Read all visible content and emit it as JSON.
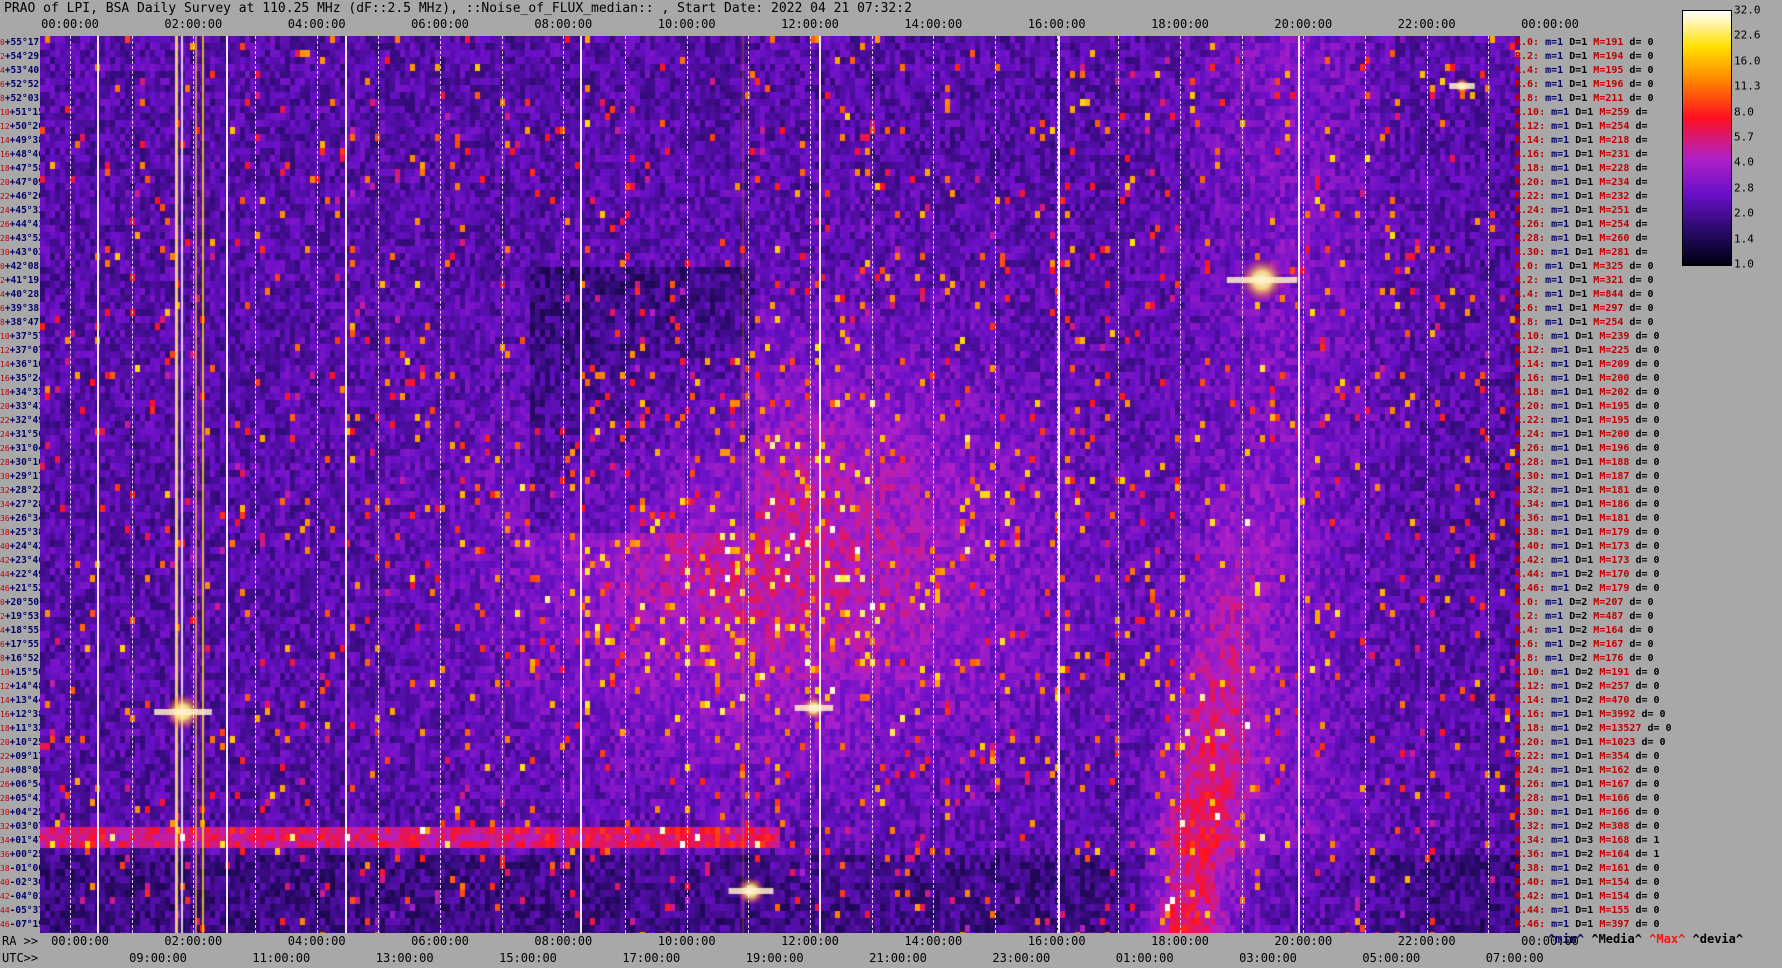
{
  "title": "PRAO of LPI, BSA Daily Survey at 110.25 MHz (dF::2.5 MHz), ::Noise_of_FLUX_median:: , Start Date: 2022 04 21 07:32:2",
  "top_ticks": [
    "00:00:00",
    "02:00:00",
    "04:00:00",
    "06:00:00",
    "08:00:00",
    "10:00:00",
    "12:00:00",
    "14:00:00",
    "16:00:00",
    "18:00:00",
    "20:00:00",
    "22:00:00",
    "00:00:00"
  ],
  "ra_prefix": "RA >>",
  "ra_ticks": [
    "00:00:00",
    "02:00:00",
    "04:00:00",
    "06:00:00",
    "08:00:00",
    "10:00:00",
    "12:00:00",
    "14:00:00",
    "16:00:00",
    "18:00:00",
    "20:00:00",
    "22:00:00",
    "00:00:00"
  ],
  "utc_prefix": "UTC>>",
  "utc_ticks": [
    "09:00:00",
    "11:00:00",
    "13:00:00",
    "15:00:00",
    "17:00:00",
    "19:00:00",
    "21:00:00",
    "23:00:00",
    "01:00:00",
    "03:00:00",
    "05:00:00",
    "07:00:00"
  ],
  "colorbar": {
    "labels": [
      "32.0",
      "22.6",
      "16.0",
      "11.3",
      "8.0",
      "5.7",
      "4.0",
      "2.8",
      "2.0",
      "1.4",
      "1.0"
    ],
    "colors": [
      "#000010",
      "#2a0a6b",
      "#6a10c8",
      "#b020c8",
      "#ff1020",
      "#ff8000",
      "#ffe000",
      "#ffffff"
    ]
  },
  "legend": {
    "min": "^min^",
    "median": "^Media^",
    "max": "^Max^",
    "dev": "^devia^"
  },
  "declinations": [
    {
      "i": "0",
      "d": "+55°17'"
    },
    {
      "i": "2",
      "d": "+54°29'"
    },
    {
      "i": "4",
      "d": "+53°40'"
    },
    {
      "i": "6",
      "d": "+52°52'"
    },
    {
      "i": "8",
      "d": "+52°03'"
    },
    {
      "i": "10",
      "d": "+51°15'"
    },
    {
      "i": "12",
      "d": "+50°26'"
    },
    {
      "i": "14",
      "d": "+49°38'"
    },
    {
      "i": "16",
      "d": "+48°46'"
    },
    {
      "i": "18",
      "d": "+47°58'"
    },
    {
      "i": "20",
      "d": "+47°09'"
    },
    {
      "i": "22",
      "d": "+46°20'"
    },
    {
      "i": "24",
      "d": "+45°31'"
    },
    {
      "i": "26",
      "d": "+44°41'"
    },
    {
      "i": "28",
      "d": "+43°52'"
    },
    {
      "i": "30",
      "d": "+43°03'"
    },
    {
      "i": "0",
      "d": "+42°08'"
    },
    {
      "i": "2",
      "d": "+41°19'"
    },
    {
      "i": "4",
      "d": "+40°28'"
    },
    {
      "i": "6",
      "d": "+39°38'"
    },
    {
      "i": "8",
      "d": "+38°47'"
    },
    {
      "i": "10",
      "d": "+37°57'"
    },
    {
      "i": "12",
      "d": "+37°07'"
    },
    {
      "i": "14",
      "d": "+36°16'"
    },
    {
      "i": "16",
      "d": "+35°24'"
    },
    {
      "i": "18",
      "d": "+34°32'"
    },
    {
      "i": "20",
      "d": "+33°41'"
    },
    {
      "i": "22",
      "d": "+32°49'"
    },
    {
      "i": "24",
      "d": "+31°56'"
    },
    {
      "i": "26",
      "d": "+31°04'"
    },
    {
      "i": "28",
      "d": "+30°10'"
    },
    {
      "i": "30",
      "d": "+29°17'"
    },
    {
      "i": "32",
      "d": "+28°22'"
    },
    {
      "i": "34",
      "d": "+27°28'"
    },
    {
      "i": "36",
      "d": "+26°34'"
    },
    {
      "i": "38",
      "d": "+25°38'"
    },
    {
      "i": "40",
      "d": "+24°42'"
    },
    {
      "i": "42",
      "d": "+23°46'"
    },
    {
      "i": "44",
      "d": "+22°49'"
    },
    {
      "i": "46",
      "d": "+21°52'"
    },
    {
      "i": "0",
      "d": "+20°50'"
    },
    {
      "i": "2",
      "d": "+19°53'"
    },
    {
      "i": "4",
      "d": "+18°55'"
    },
    {
      "i": "6",
      "d": "+17°55'"
    },
    {
      "i": "8",
      "d": "+16°52'"
    },
    {
      "i": "10",
      "d": "+15°50'"
    },
    {
      "i": "12",
      "d": "+14°48'"
    },
    {
      "i": "14",
      "d": "+13°44'"
    },
    {
      "i": "16",
      "d": "+12°38'"
    },
    {
      "i": "18",
      "d": "+11°32'"
    },
    {
      "i": "20",
      "d": "+10°25'"
    },
    {
      "i": "22",
      "d": "+09°17'"
    },
    {
      "i": "24",
      "d": "+08°05'"
    },
    {
      "i": "26",
      "d": "+06°54'"
    },
    {
      "i": "28",
      "d": "+05°41'"
    },
    {
      "i": "30",
      "d": "+04°25'"
    },
    {
      "i": "32",
      "d": "+03°07'"
    },
    {
      "i": "34",
      "d": "+01°47'"
    },
    {
      "i": "36",
      "d": "+00°25'"
    },
    {
      "i": "38",
      "d": "-01°00'"
    },
    {
      "i": "40",
      "d": "-02°30'"
    },
    {
      "i": "42",
      "d": "-04°01'"
    },
    {
      "i": "44",
      "d": "-05°37'"
    },
    {
      "i": "46",
      "d": "-07°19'"
    }
  ],
  "side_rows": [
    {
      "r": "R.0:",
      "m": "m=1",
      "D": "D=1",
      "M": "M=191",
      "d": "d= 0"
    },
    {
      "r": "R.2:",
      "m": "m=1",
      "D": "D=1",
      "M": "M=194",
      "d": "d= 0"
    },
    {
      "r": "R.4:",
      "m": "m=1",
      "D": "D=1",
      "M": "M=195",
      "d": "d= 0"
    },
    {
      "r": "R.6:",
      "m": "m=1",
      "D": "D=1",
      "M": "M=196",
      "d": "d= 0"
    },
    {
      "r": "R.8:",
      "m": "m=1",
      "D": "D=1",
      "M": "M=211",
      "d": "d= 0"
    },
    {
      "r": "R.10:",
      "m": "m=1",
      "D": "D=1",
      "M": "M=259",
      "d": "d="
    },
    {
      "r": "R.12:",
      "m": "m=1",
      "D": "D=1",
      "M": "M=254",
      "d": "d="
    },
    {
      "r": "R.14:",
      "m": "m=1",
      "D": "D=1",
      "M": "M=218",
      "d": "d="
    },
    {
      "r": "R.16:",
      "m": "m=1",
      "D": "D=1",
      "M": "M=231",
      "d": "d="
    },
    {
      "r": "R.18:",
      "m": "m=1",
      "D": "D=1",
      "M": "M=228",
      "d": "d="
    },
    {
      "r": "R.20:",
      "m": "m=1",
      "D": "D=1",
      "M": "M=234",
      "d": "d="
    },
    {
      "r": "R.22:",
      "m": "m=1",
      "D": "D=1",
      "M": "M=232",
      "d": "d="
    },
    {
      "r": "R.24:",
      "m": "m=1",
      "D": "D=1",
      "M": "M=251",
      "d": "d="
    },
    {
      "r": "R.26:",
      "m": "m=1",
      "D": "D=1",
      "M": "M=254",
      "d": "d="
    },
    {
      "r": "R.28:",
      "m": "m=1",
      "D": "D=1",
      "M": "M=260",
      "d": "d="
    },
    {
      "r": "R.30:",
      "m": "m=1",
      "D": "D=1",
      "M": "M=281",
      "d": "d="
    },
    {
      "r": "R.0:",
      "m": "m=1",
      "D": "D=1",
      "M": "M=325",
      "d": "d= 0"
    },
    {
      "r": "R.2:",
      "m": "m=1",
      "D": "D=1",
      "M": "M=321",
      "d": "d= 0"
    },
    {
      "r": "R.4:",
      "m": "m=1",
      "D": "D=1",
      "M": "M=844",
      "d": "d= 0"
    },
    {
      "r": "R.6:",
      "m": "m=1",
      "D": "D=1",
      "M": "M=297",
      "d": "d= 0"
    },
    {
      "r": "R.8:",
      "m": "m=1",
      "D": "D=1",
      "M": "M=254",
      "d": "d= 0"
    },
    {
      "r": "R.10:",
      "m": "m=1",
      "D": "D=1",
      "M": "M=239",
      "d": "d= 0"
    },
    {
      "r": "R.12:",
      "m": "m=1",
      "D": "D=1",
      "M": "M=225",
      "d": "d= 0"
    },
    {
      "r": "R.14:",
      "m": "m=1",
      "D": "D=1",
      "M": "M=209",
      "d": "d= 0"
    },
    {
      "r": "R.16:",
      "m": "m=1",
      "D": "D=1",
      "M": "M=200",
      "d": "d= 0"
    },
    {
      "r": "R.18:",
      "m": "m=1",
      "D": "D=1",
      "M": "M=202",
      "d": "d= 0"
    },
    {
      "r": "R.20:",
      "m": "m=1",
      "D": "D=1",
      "M": "M=195",
      "d": "d= 0"
    },
    {
      "r": "R.22:",
      "m": "m=1",
      "D": "D=1",
      "M": "M=195",
      "d": "d= 0"
    },
    {
      "r": "R.24:",
      "m": "m=1",
      "D": "D=1",
      "M": "M=200",
      "d": "d= 0"
    },
    {
      "r": "R.26:",
      "m": "m=1",
      "D": "D=1",
      "M": "M=196",
      "d": "d= 0"
    },
    {
      "r": "R.28:",
      "m": "m=1",
      "D": "D=1",
      "M": "M=188",
      "d": "d= 0"
    },
    {
      "r": "R.30:",
      "m": "m=1",
      "D": "D=1",
      "M": "M=187",
      "d": "d= 0"
    },
    {
      "r": "R.32:",
      "m": "m=1",
      "D": "D=1",
      "M": "M=181",
      "d": "d= 0"
    },
    {
      "r": "R.34:",
      "m": "m=1",
      "D": "D=1",
      "M": "M=186",
      "d": "d= 0"
    },
    {
      "r": "R.36:",
      "m": "m=1",
      "D": "D=1",
      "M": "M=181",
      "d": "d= 0"
    },
    {
      "r": "R.38:",
      "m": "m=1",
      "D": "D=1",
      "M": "M=179",
      "d": "d= 0"
    },
    {
      "r": "R.40:",
      "m": "m=1",
      "D": "D=1",
      "M": "M=173",
      "d": "d= 0"
    },
    {
      "r": "R.42:",
      "m": "m=1",
      "D": "D=1",
      "M": "M=173",
      "d": "d= 0"
    },
    {
      "r": "R.44:",
      "m": "m=1",
      "D": "D=2",
      "M": "M=170",
      "d": "d= 0"
    },
    {
      "r": "R.46:",
      "m": "m=1",
      "D": "D=2",
      "M": "M=179",
      "d": "d= 0"
    },
    {
      "r": "R.0:",
      "m": "m=1",
      "D": "D=2",
      "M": "M=207",
      "d": "d= 0"
    },
    {
      "r": "R.2:",
      "m": "m=1",
      "D": "D=2",
      "M": "M=487",
      "d": "d= 0"
    },
    {
      "r": "R.4:",
      "m": "m=1",
      "D": "D=2",
      "M": "M=164",
      "d": "d= 0"
    },
    {
      "r": "R.6:",
      "m": "m=1",
      "D": "D=2",
      "M": "M=167",
      "d": "d= 0"
    },
    {
      "r": "R.8:",
      "m": "m=1",
      "D": "D=2",
      "M": "M=176",
      "d": "d= 0"
    },
    {
      "r": "R.10:",
      "m": "m=1",
      "D": "D=2",
      "M": "M=191",
      "d": "d= 0"
    },
    {
      "r": "R.12:",
      "m": "m=1",
      "D": "D=2",
      "M": "M=257",
      "d": "d= 0"
    },
    {
      "r": "R.14:",
      "m": "m=1",
      "D": "D=2",
      "M": "M=470",
      "d": "d= 0"
    },
    {
      "r": "R.16:",
      "m": "m=1",
      "D": "D=1",
      "M": "M=3992",
      "d": "d= 0"
    },
    {
      "r": "R.18:",
      "m": "m=1",
      "D": "D=2",
      "M": "M=13527",
      "d": "d= 0"
    },
    {
      "r": "R.20:",
      "m": "m=1",
      "D": "D=1",
      "M": "M=1023",
      "d": "d= 0"
    },
    {
      "r": "R.22:",
      "m": "m=1",
      "D": "D=1",
      "M": "M=354",
      "d": "d= 0"
    },
    {
      "r": "R.24:",
      "m": "m=1",
      "D": "D=1",
      "M": "M=162",
      "d": "d= 0"
    },
    {
      "r": "R.26:",
      "m": "m=1",
      "D": "D=1",
      "M": "M=167",
      "d": "d= 0"
    },
    {
      "r": "R.28:",
      "m": "m=1",
      "D": "D=1",
      "M": "M=166",
      "d": "d= 0"
    },
    {
      "r": "R.30:",
      "m": "m=1",
      "D": "D=1",
      "M": "M=166",
      "d": "d= 0"
    },
    {
      "r": "R.32:",
      "m": "m=1",
      "D": "D=2",
      "M": "M=308",
      "d": "d= 0"
    },
    {
      "r": "R.34:",
      "m": "m=1",
      "D": "D=3",
      "M": "M=168",
      "d": "d= 1"
    },
    {
      "r": "R.36:",
      "m": "m=1",
      "D": "D=2",
      "M": "M=164",
      "d": "d= 1"
    },
    {
      "r": "R.38:",
      "m": "m=1",
      "D": "D=2",
      "M": "M=161",
      "d": "d= 0"
    },
    {
      "r": "R.40:",
      "m": "m=1",
      "D": "D=1",
      "M": "M=154",
      "d": "d= 0"
    },
    {
      "r": "R.42:",
      "m": "m=1",
      "D": "D=1",
      "M": "M=154",
      "d": "d= 0"
    },
    {
      "r": "R.44:",
      "m": "m=1",
      "D": "D=1",
      "M": "M=155",
      "d": "d= 0"
    },
    {
      "r": "R.46:",
      "m": "m=1",
      "D": "D=1",
      "M": "M=397",
      "d": "d= 0"
    }
  ],
  "chart_data": {
    "type": "heatmap",
    "title": "PRAO of LPI, BSA Daily Survey at 110.25 MHz (dF::2.5 MHz), ::Noise_of_FLUX_median:: , Start Date: 2022 04 21 07:32:2",
    "x_axis": "RA",
    "x_range": [
      "00:00:00",
      "24:00:00"
    ],
    "y_range": [
      "+55°17'",
      "-07°19'"
    ],
    "color_scale": [
      1.0,
      32.0
    ],
    "log_scale": true,
    "rows": 64
  }
}
